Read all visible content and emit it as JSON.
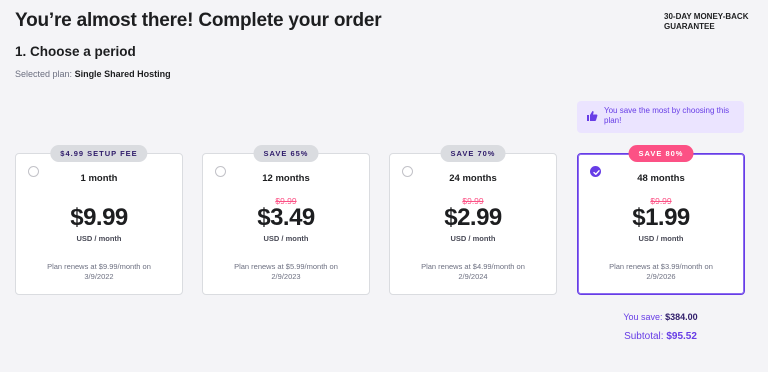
{
  "header": {
    "title": "You’re almost there! Complete your order",
    "guarantee": "30-DAY MONEY-BACK GUARANTEE"
  },
  "step": {
    "title": "1. Choose a period",
    "selected_label": "Selected plan:",
    "selected_value": "Single Shared Hosting"
  },
  "tooltip": {
    "icon": "thumbs-up-icon",
    "text": "You save the most by choosing this plan!"
  },
  "plans": [
    {
      "badge": "$4.99 SETUP FEE",
      "period": "1 month",
      "old_price": "",
      "price": "$9.99",
      "unit": "USD / month",
      "renew": "Plan renews at $9.99/month on 3/9/2022",
      "selected": false
    },
    {
      "badge": "SAVE 65%",
      "period": "12 months",
      "old_price": "$9.99",
      "price": "$3.49",
      "unit": "USD / month",
      "renew": "Plan renews at $5.99/month on 2/9/2023",
      "selected": false
    },
    {
      "badge": "SAVE 70%",
      "period": "24 months",
      "old_price": "$9.99",
      "price": "$2.99",
      "unit": "USD / month",
      "renew": "Plan renews at $4.99/month on 2/9/2024",
      "selected": false
    },
    {
      "badge": "SAVE 80%",
      "period": "48 months",
      "old_price": "$9.99",
      "price": "$1.99",
      "unit": "USD / month",
      "renew": "Plan renews at $3.99/month on 2/9/2026",
      "selected": true
    }
  ],
  "summary": {
    "save_label": "You save:",
    "save_value": "$384.00",
    "subtotal_label": "Subtotal:",
    "subtotal_value": "$95.52"
  },
  "colors": {
    "accent": "#673de6",
    "sale": "#fc5185",
    "background": "#f4f4f7"
  }
}
